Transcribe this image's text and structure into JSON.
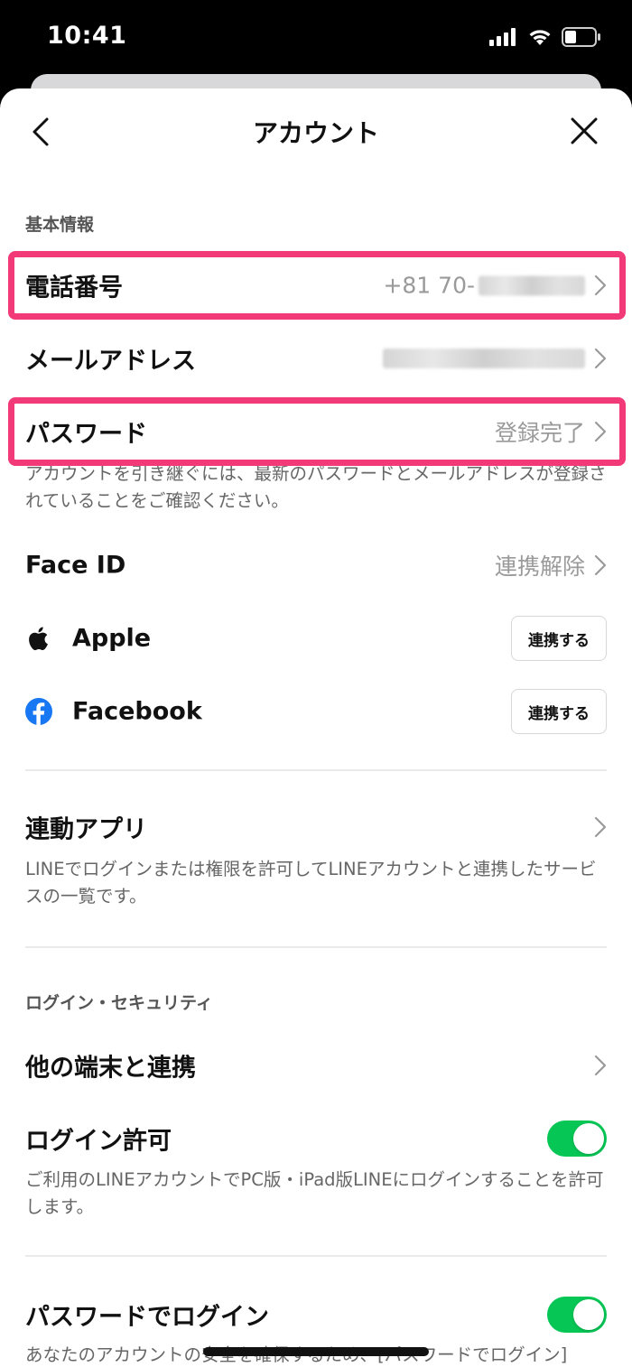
{
  "status_bar": {
    "time": "10:41"
  },
  "nav": {
    "title": "アカウント"
  },
  "basic_info": {
    "header": "基本情報",
    "phone": {
      "label": "電話番号",
      "value_prefix": "+81 70-"
    },
    "email": {
      "label": "メールアドレス"
    },
    "password": {
      "label": "パスワード",
      "value": "登録完了",
      "note": "アカウントを引き継ぐには、最新のパスワードとメールアドレスが登録されていることをご確認ください。"
    },
    "face_id": {
      "label": "Face ID",
      "value": "連携解除"
    },
    "apple": {
      "label": "Apple",
      "button": "連携する"
    },
    "facebook": {
      "label": "Facebook",
      "button": "連携する"
    }
  },
  "linked_apps": {
    "label": "連動アプリ",
    "note": "LINEでログインまたは権限を許可してLINEアカウントと連携したサービスの一覧です。"
  },
  "login_security": {
    "header": "ログイン・セキュリティ",
    "other_devices": {
      "label": "他の端末と連携"
    },
    "login_allow": {
      "label": "ログイン許可",
      "enabled": true,
      "note": "ご利用のLINEアカウントでPC版・iPad版LINEにログインすることを許可します。"
    },
    "password_login": {
      "label": "パスワードでログイン",
      "enabled": true,
      "note": "あなたのアカウントの安全を確保するため、[パスワードでログイン]"
    }
  },
  "colors": {
    "highlight": "#f23a78",
    "toggle_on": "#06c755",
    "facebook": "#1877f2"
  }
}
